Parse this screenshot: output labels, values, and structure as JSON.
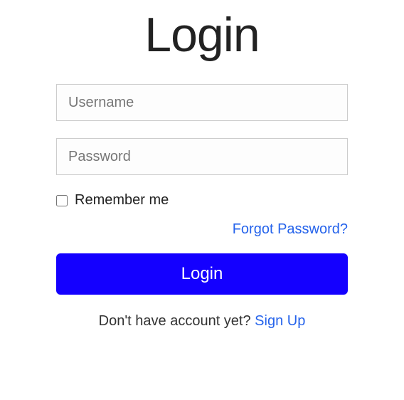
{
  "title": "Login",
  "username": {
    "placeholder": "Username",
    "value": ""
  },
  "password": {
    "placeholder": "Password",
    "value": ""
  },
  "remember": {
    "label": "Remember me",
    "checked": false
  },
  "forgot": {
    "label": "Forgot Password?"
  },
  "loginButton": {
    "label": "Login"
  },
  "signup": {
    "prompt": "Don't have account yet? ",
    "linkLabel": "Sign Up"
  }
}
